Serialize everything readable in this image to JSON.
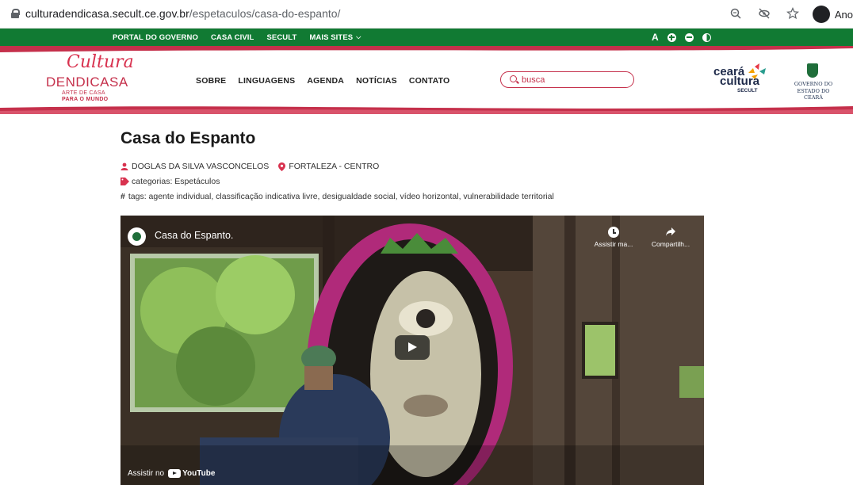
{
  "browser": {
    "url_host": "culturadendicasa.secult.ce.gov.br",
    "url_path": "/espetaculos/casa-do-espanto/",
    "profile_name": "Ano"
  },
  "gov_bar": {
    "links": [
      "PORTAL DO GOVERNO",
      "CASA CIVIL",
      "SECULT",
      "MAIS SITES"
    ],
    "font_label": "A",
    "color": "#117a33"
  },
  "logo": {
    "script": "Cultura",
    "brand": "DENDICASA",
    "sub1": "ARTE DE CASA",
    "sub2": "PARA O MUNDO"
  },
  "nav": [
    "SOBRE",
    "LINGUAGENS",
    "AGENDA",
    "NOTÍCIAS",
    "CONTATO"
  ],
  "search": {
    "placeholder": "busca"
  },
  "ceara_logo": {
    "line1": "ceará",
    "line2": "cultura",
    "line3": "SECULT"
  },
  "gov_logo": {
    "line1": "GOVERNO DO",
    "line2": "ESTADO DO CEARÁ"
  },
  "post": {
    "title": "Casa do Espanto",
    "author": "DOGLAS DA SILVA VASCONCELOS",
    "location": "FORTALEZA - CENTRO",
    "categories": "categorias: Espetáculos",
    "tags": "tags: agente individual, classificação indicativa livre, desigualdade social, vídeo horizontal, vulnerabilidade territorial"
  },
  "video": {
    "title": "Casa do Espanto.",
    "watch_later": "Assistir ma...",
    "share": "Compartilh...",
    "watch_on": "Assistir no",
    "youtube": "YouTube"
  },
  "colors": {
    "accent": "#c5304b",
    "green": "#117a33"
  }
}
